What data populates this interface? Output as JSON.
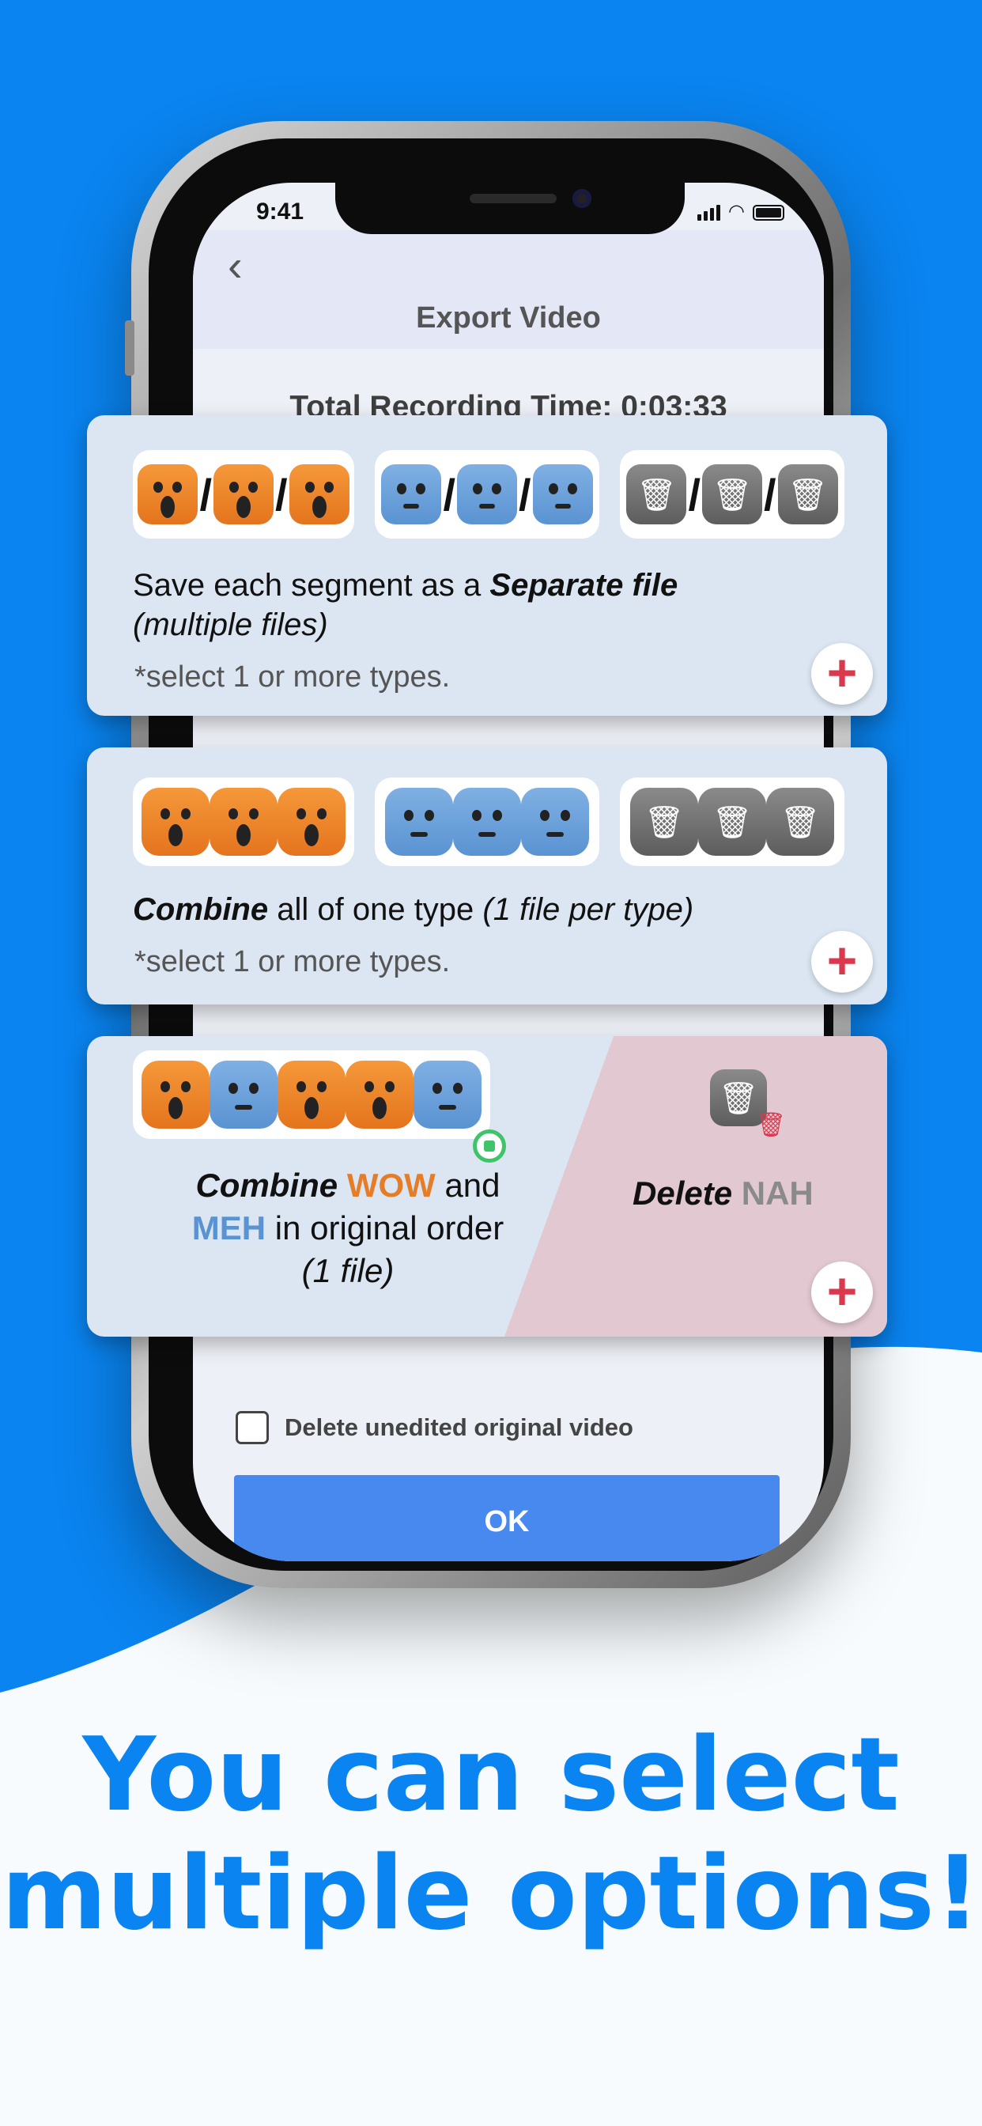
{
  "status_bar": {
    "time": "9:41"
  },
  "nav": {
    "back_glyph": "‹",
    "title": "Export Video"
  },
  "summary": {
    "total_recording": "Total Recording Time: 0:03:33"
  },
  "options": [
    {
      "text_plain": "Save each segment as a ",
      "text_emph": "Separate file",
      "text_sub": "(multiple files)",
      "note": "*select 1 or more types."
    },
    {
      "text_emph": "Combine",
      "text_plain": " all of one type ",
      "text_sub": "(1 file per type)",
      "note": "*select 1 or more types."
    },
    {
      "combine_emph": "Combine",
      "wow": "WOW",
      "and": "and",
      "meh": "MEH",
      "rest": "in original order",
      "sub": "(1 file)",
      "delete_emph": "Delete",
      "nah": "NAH"
    }
  ],
  "delete_original": {
    "label": "Delete unedited original video"
  },
  "ok_button": {
    "label": "OK"
  },
  "headline": {
    "line1": "You can select",
    "line2": "multiple options!"
  },
  "icons": {
    "wow_face": "wow-face-icon",
    "meh_face": "meh-face-icon",
    "nah_trash": "trash-icon",
    "add": "plus-icon",
    "save_lock": "lock-icon"
  },
  "colors": {
    "brand_blue": "#0a84f0",
    "wow_orange": "#e57c28",
    "meh_blue": "#5a93d2",
    "nah_gray": "#8a8a8a",
    "add_red": "#d9394d",
    "ok_blue": "#4789ef"
  }
}
